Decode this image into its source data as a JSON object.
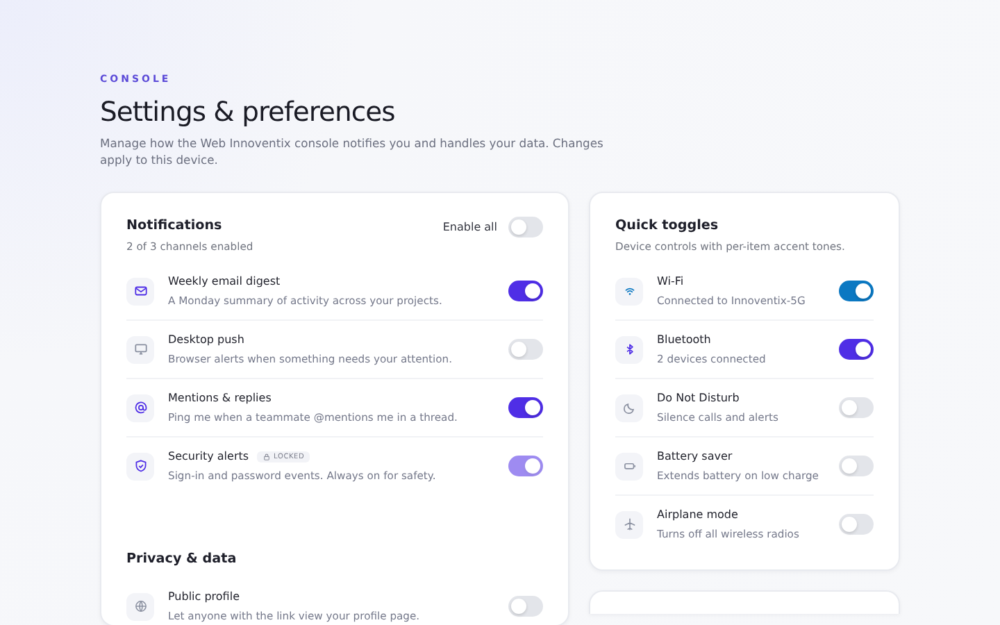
{
  "header": {
    "eyebrow": "CONSOLE",
    "title": "Settings & preferences",
    "description": "Manage how the Web Innoventix console notifies you and handles your data. Changes apply to this device."
  },
  "notifications": {
    "title": "Notifications",
    "subtitle": "2 of 3 channels enabled",
    "enable_all": {
      "label": "Enable all",
      "on": false
    },
    "items": [
      {
        "title": "Weekly email digest",
        "description": "A Monday summary of activity across your projects.",
        "on": true,
        "disabled": false
      },
      {
        "title": "Desktop push",
        "description": "Browser alerts when something needs your attention.",
        "on": false,
        "disabled": false
      },
      {
        "title": "Mentions & replies",
        "description": "Ping me when a teammate @mentions me in a thread.",
        "on": true,
        "disabled": false
      },
      {
        "title": "Security alerts",
        "badge": "LOCKED",
        "description": "Sign-in and password events. Always on for safety.",
        "on": true,
        "disabled": true
      }
    ]
  },
  "privacy": {
    "title": "Privacy & data",
    "items": [
      {
        "title": "Public profile",
        "description": "Let anyone with the link view your profile page.",
        "on": false,
        "disabled": false
      }
    ]
  },
  "quick_toggles": {
    "title": "Quick toggles",
    "subtitle": "Device controls with per-item accent tones.",
    "items": [
      {
        "title": "Wi-Fi",
        "description": "Connected to Innoventix-5G",
        "on": true,
        "color": "#0b78c2"
      },
      {
        "title": "Bluetooth",
        "description": "2 devices connected",
        "on": true,
        "color": "#4f2ee6"
      },
      {
        "title": "Do Not Disturb",
        "description": "Silence calls and alerts",
        "on": false
      },
      {
        "title": "Battery saver",
        "description": "Extends battery on low charge",
        "on": false
      },
      {
        "title": "Airplane mode",
        "description": "Turns off all wireless radios",
        "on": false
      }
    ]
  }
}
